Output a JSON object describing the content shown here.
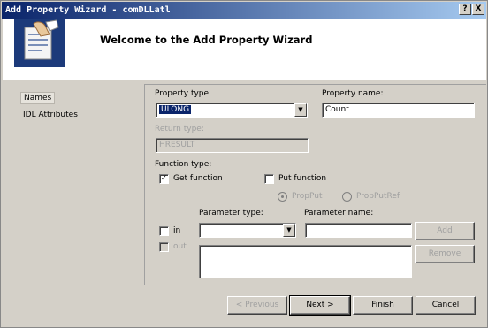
{
  "window": {
    "title": "Add Property Wizard - comDLLatl"
  },
  "titlebar_buttons": {
    "help": "?",
    "close": "X"
  },
  "header": {
    "title": "Welcome to the Add Property Wizard",
    "icon": "wizard-document-hand-icon"
  },
  "sidebar": {
    "items": [
      {
        "label": "Names",
        "active": true
      },
      {
        "label": "IDL Attributes",
        "active": false
      }
    ]
  },
  "form": {
    "property_type_label": "Property type:",
    "property_type_value": "ULONG",
    "property_name_label": "Property name:",
    "property_name_value": "Count",
    "return_type_label": "Return type:",
    "return_type_value": "HRESULT",
    "function_type_label": "Function type:",
    "get_function_label": "Get function",
    "get_function_checked": true,
    "put_function_label": "Put function",
    "put_function_checked": false,
    "propput_label": "PropPut",
    "propputref_label": "PropPutRef",
    "in_label": "in",
    "out_label": "out",
    "parameter_type_label": "Parameter type:",
    "parameter_type_value": "",
    "parameter_name_label": "Parameter name:",
    "parameter_name_value": "",
    "add_label": "Add",
    "remove_label": "Remove"
  },
  "footer": {
    "previous": "< Previous",
    "next": "Next >",
    "finish": "Finish",
    "cancel": "Cancel"
  },
  "colors": {
    "titlebar_start": "#0a246a",
    "titlebar_end": "#a6caf0",
    "dialog_bg": "#d4d0c8",
    "selection": "#0a246a"
  }
}
